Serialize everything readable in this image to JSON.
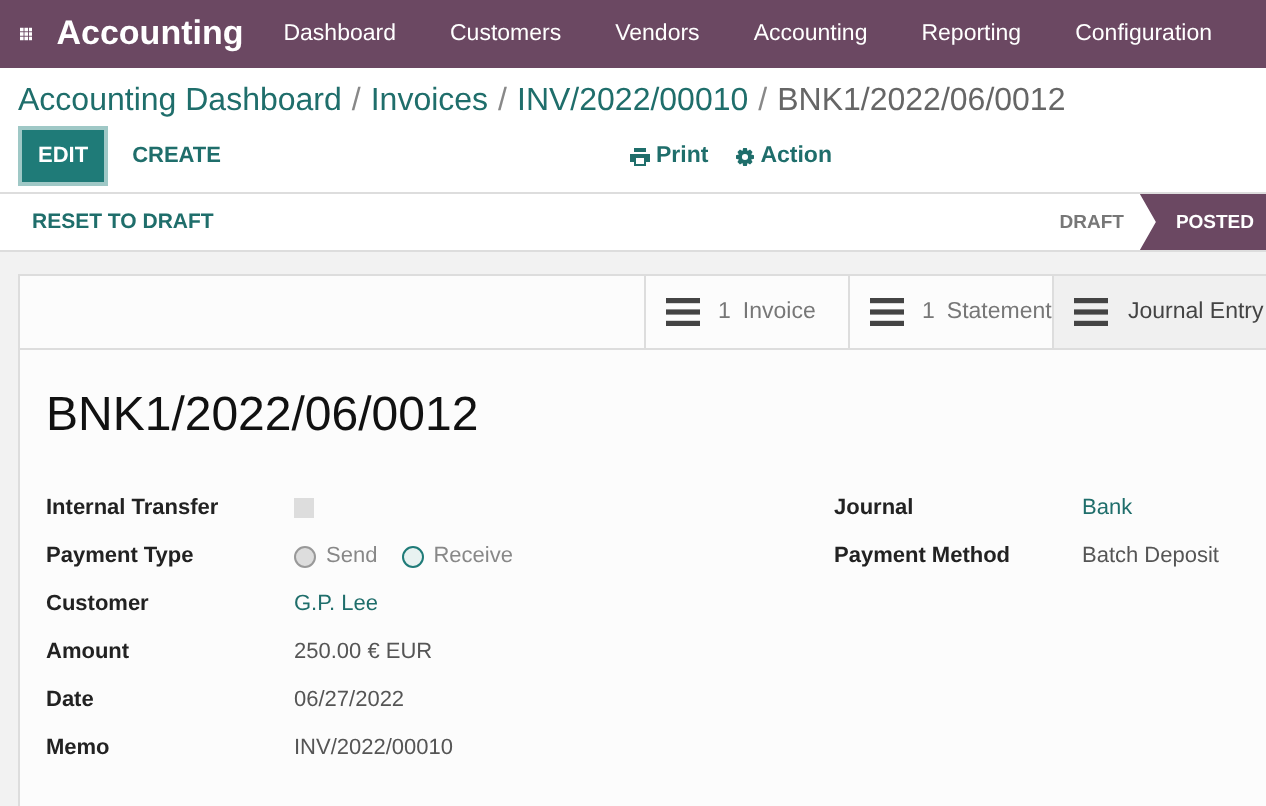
{
  "app_title": "Accounting",
  "menu": [
    "Dashboard",
    "Customers",
    "Vendors",
    "Accounting",
    "Reporting",
    "Configuration"
  ],
  "breadcrumbs": [
    {
      "label": "Accounting Dashboard",
      "current": false
    },
    {
      "label": "Invoices",
      "current": false
    },
    {
      "label": "INV/2022/00010",
      "current": false
    },
    {
      "label": "BNK1/2022/06/0012",
      "current": true
    }
  ],
  "breadcrumb_separator": "/",
  "buttons": [
    {
      "label": "EDIT",
      "primary": true
    },
    {
      "label": "CREATE",
      "primary": false
    }
  ],
  "actions": [
    {
      "label": "Print",
      "kind": "print"
    },
    {
      "label": "Action",
      "kind": "gear"
    }
  ],
  "header_button": "RESET TO DRAFT",
  "stages": [
    {
      "label": "DRAFT",
      "selected": false
    },
    {
      "label": "POSTED",
      "selected": true
    }
  ],
  "smart_buttons": [
    {
      "count": "1",
      "label": "Invoice"
    },
    {
      "count": "1",
      "label": "Statement"
    },
    {
      "label": "Journal Entry"
    }
  ],
  "record_title": "BNK1/2022/06/0012",
  "left_fields": [
    {
      "label": "Internal Transfer",
      "kind": "checkbox",
      "checked": false
    },
    {
      "label": "Payment Type",
      "kind": "radio",
      "options": [
        {
          "label": "Send",
          "selected": false
        },
        {
          "label": "Receive",
          "selected": true
        }
      ]
    },
    {
      "label": "Customer",
      "kind": "link",
      "value": "G.P. Lee"
    },
    {
      "label": "Amount",
      "kind": "text",
      "value": "250.00 € EUR"
    },
    {
      "label": "Date",
      "kind": "text",
      "value": "06/27/2022"
    },
    {
      "label": "Memo",
      "kind": "text",
      "value": "INV/2022/00010"
    }
  ],
  "right_fields": [
    {
      "label": "Journal",
      "kind": "link",
      "value": "Bank"
    },
    {
      "label": "Payment Method",
      "kind": "text",
      "value": "Batch Deposit"
    }
  ]
}
